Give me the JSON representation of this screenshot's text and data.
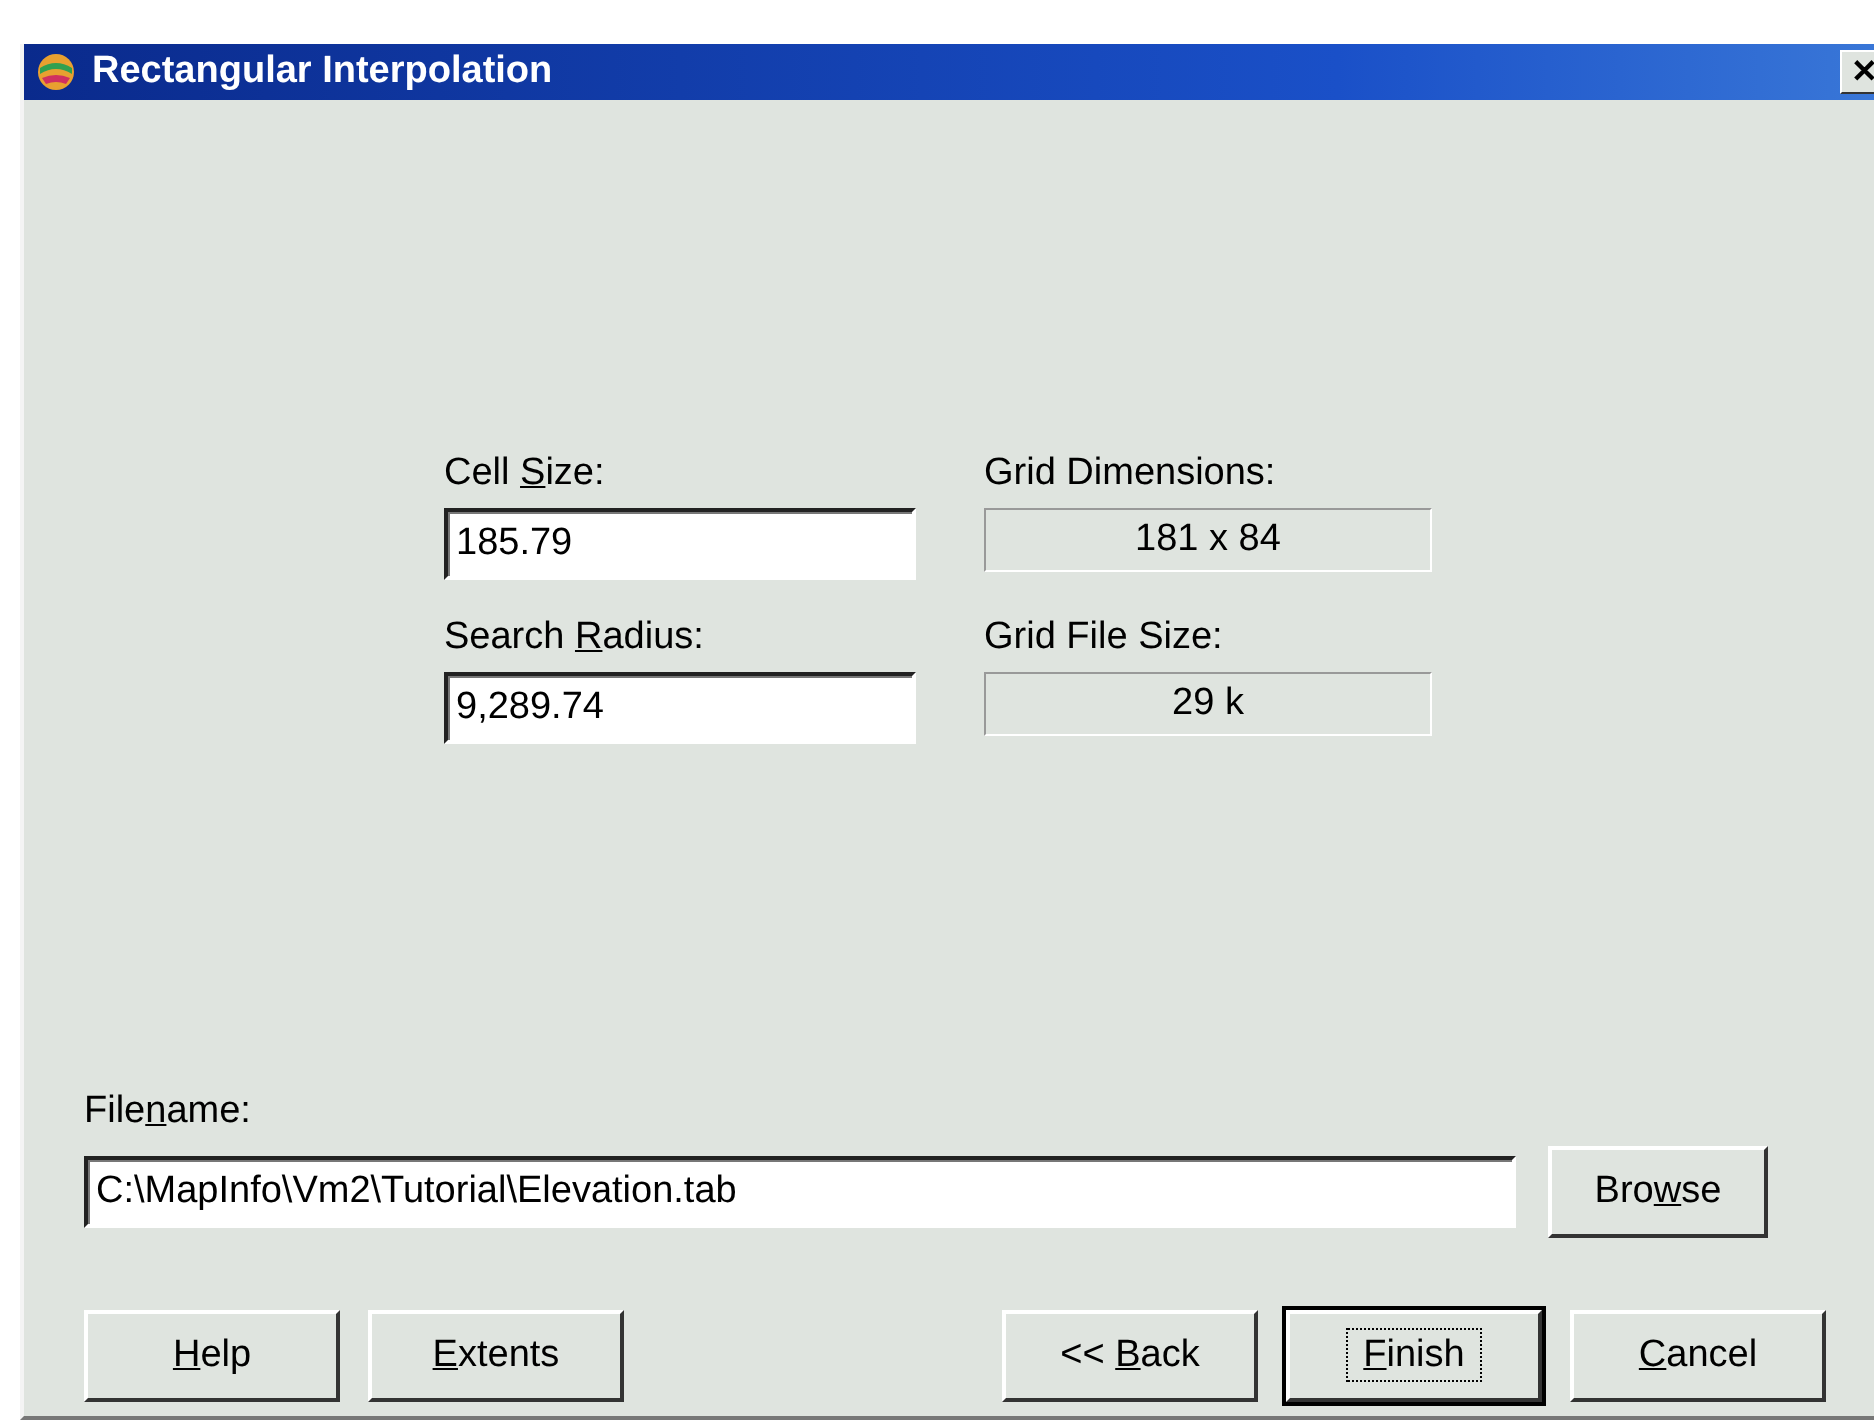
{
  "window": {
    "title": "Rectangular Interpolation",
    "close": "✕"
  },
  "fields": [
    {
      "label": {
        "before": "Cell ",
        "key": "S",
        "after": "ize:"
      },
      "value": "185.79"
    },
    {
      "label": {
        "before": "Search ",
        "key": "R",
        "after": "adius:"
      },
      "value": "9,289.74"
    }
  ],
  "readouts": [
    {
      "label": "Grid Dimensions:",
      "value": "181 x 84"
    },
    {
      "label": "Grid File Size:",
      "value": "29 k"
    }
  ],
  "filename": {
    "label": {
      "before": "File",
      "key": "n",
      "after": "ame:"
    },
    "value": "C:\\MapInfo\\Vm2\\Tutorial\\Elevation.tab"
  },
  "browse_button": {
    "before": "Bro",
    "key": "w",
    "after": "se"
  },
  "left_buttons": [
    {
      "label": {
        "key": "H",
        "after": "elp"
      },
      "default": false
    },
    {
      "label": {
        "key": "E",
        "after": "xtents"
      },
      "default": false
    }
  ],
  "right_buttons": [
    {
      "label": {
        "before": "<< ",
        "key": "B",
        "after": "ack"
      },
      "default": false
    },
    {
      "label": {
        "key": "F",
        "after": "inish"
      },
      "default": true
    },
    {
      "label": {
        "key": "C",
        "after": "ancel"
      },
      "default": false
    }
  ]
}
